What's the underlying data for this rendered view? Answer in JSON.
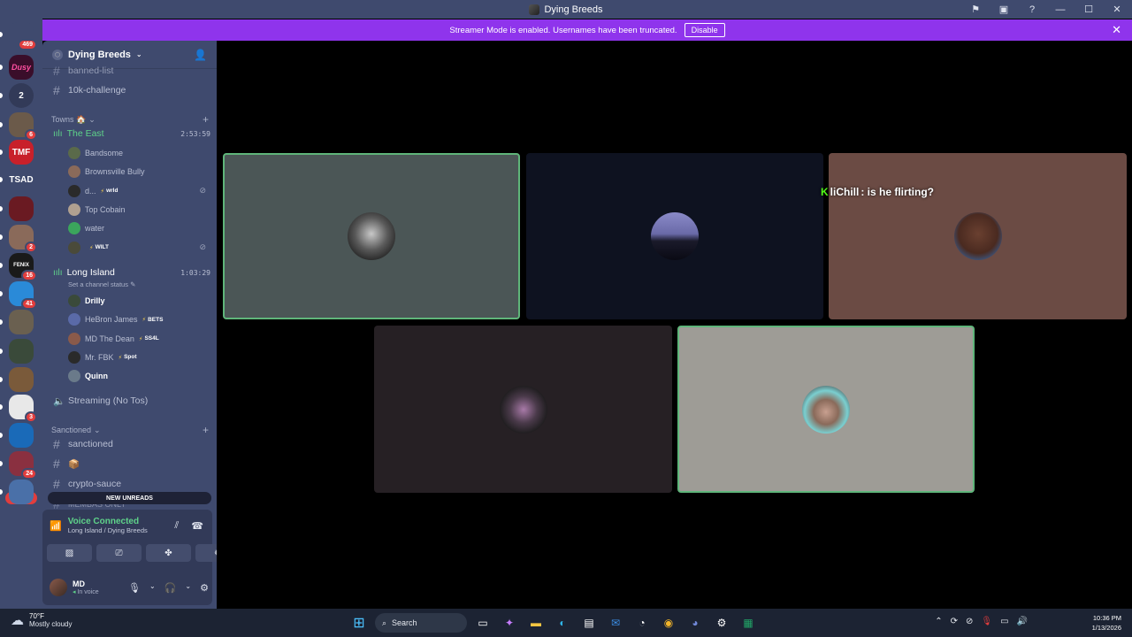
{
  "window": {
    "title": "Dying Breeds"
  },
  "banner": {
    "message": "Streamer Mode is enabled. Usernames have been truncated.",
    "disable_label": "Disable"
  },
  "guilds": [
    {
      "label": "",
      "badge": "469",
      "color": "#3f4a6e"
    },
    {
      "label": "Dusy",
      "badge": "",
      "color": "#3a0e2a"
    },
    {
      "label": "2",
      "badge": "",
      "color": "#323a58"
    },
    {
      "label": "",
      "badge": "6",
      "color": "#6b5a4a"
    },
    {
      "label": "TMF",
      "badge": "",
      "color": "#c8202a"
    },
    {
      "label": "TSAD",
      "badge": "",
      "color": "#3f4a6e"
    },
    {
      "label": "",
      "badge": "",
      "color": "#6a1a22"
    },
    {
      "label": "",
      "badge": "2",
      "color": "#8a6a5a"
    },
    {
      "label": "FENIX",
      "badge": "16",
      "color": "#1a1a1a"
    },
    {
      "label": "",
      "badge": "41",
      "color": "#2a8ad8"
    },
    {
      "label": "",
      "badge": "",
      "color": "#6a6050"
    },
    {
      "label": "",
      "badge": "",
      "color": "#3a4a3a"
    },
    {
      "label": "",
      "badge": "",
      "color": "#7a5a3a"
    },
    {
      "label": "",
      "badge": "3",
      "color": "#e8e8e8"
    },
    {
      "label": "",
      "badge": "",
      "color": "#1a6ab8"
    },
    {
      "label": "",
      "badge": "24",
      "color": "#8a3040"
    },
    {
      "label": "",
      "badge": "",
      "color": "#4a70a8"
    }
  ],
  "new_badge": "NEW",
  "server": {
    "name": "Dying Breeds"
  },
  "channels_top": [
    "banned-list",
    "10k-challenge"
  ],
  "category_towns": "Towns 🏠",
  "voice_east": {
    "name": "The East",
    "time": "2:53:59",
    "users": [
      {
        "name": "Bandsome",
        "tag": "",
        "color": "#5a6a4a"
      },
      {
        "name": "Brownsville Bully",
        "tag": "",
        "color": "#8a6a5a"
      },
      {
        "name": "d...",
        "tag": "wrld",
        "color": "#2a2a2a"
      },
      {
        "name": "Top Cobain",
        "tag": "",
        "color": "#b0a090"
      },
      {
        "name": "water",
        "tag": "",
        "color": "#3ba55c"
      },
      {
        "name": "",
        "tag": "WILT",
        "color": "#4a4a3a"
      }
    ]
  },
  "voice_li": {
    "name": "Long Island",
    "time": "1:03:29",
    "status": "Set a channel status",
    "users": [
      {
        "name": "Drilly",
        "tag": "",
        "color": "#3a4a3a"
      },
      {
        "name": "HeBron James",
        "tag": "BETS",
        "color": "#5a6aa8"
      },
      {
        "name": "MD The Dean",
        "tag": "SS4L",
        "color": "#8a5a4a"
      },
      {
        "name": "Mr. FBK",
        "tag": "Spot",
        "color": "#2a2a2a"
      },
      {
        "name": "Quinn",
        "tag": "",
        "color": "#6a7a8a"
      }
    ]
  },
  "streaming_channel": "Streaming (No Tos)",
  "category_sanctioned": "Sanctioned",
  "channels_sanctioned": [
    "sanctioned",
    "📦",
    "crypto-sauce",
    "MEMBAS ONLY"
  ],
  "new_unreads": "NEW UNREADS",
  "voice_panel": {
    "title": "Voice Connected",
    "sub": "Long Island / Dying Breeds"
  },
  "user_panel": {
    "name": "MD",
    "status": "In voice"
  },
  "overlay_chat": {
    "name": "liChill",
    "message": ": is he flirting?"
  },
  "taskbar": {
    "temp": "70°F",
    "weather": "Mostly cloudy",
    "search": "Search",
    "time": "10:36 PM",
    "date": "1/13/2026"
  }
}
